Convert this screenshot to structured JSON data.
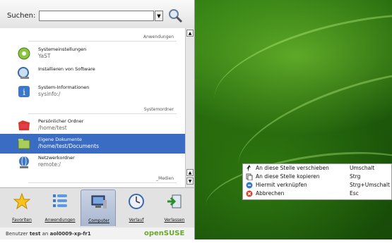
{
  "search": {
    "label": "Suchen:",
    "value": ""
  },
  "sections": {
    "applications": "Anwendungen",
    "system_folders": "Systemordner",
    "media": "_Medien"
  },
  "items": [
    {
      "title": "Systemeinstellungen",
      "subtitle": "YaST",
      "icon": "yast-icon"
    },
    {
      "title": "Installieren von Software",
      "subtitle": "",
      "icon": "software-install-icon"
    },
    {
      "title": "System-Informationen",
      "subtitle": "sysinfo:/",
      "icon": "info-icon"
    },
    {
      "title": "Persönlicher Ordner",
      "subtitle": "/home/test",
      "icon": "home-folder-icon"
    },
    {
      "title": "Eigene Dokumente",
      "subtitle": "/home/test/Documents",
      "icon": "documents-folder-icon"
    },
    {
      "title": "Netzwerkordner",
      "subtitle": "remote:/",
      "icon": "network-folder-icon"
    }
  ],
  "tabs": [
    {
      "label": "Favoriten",
      "icon": "star-icon"
    },
    {
      "label": "Anwendungen",
      "icon": "applications-list-icon"
    },
    {
      "label": "Computer",
      "icon": "computer-icon"
    },
    {
      "label": "Verlauf",
      "icon": "clock-icon"
    },
    {
      "label": "Verlassen",
      "icon": "leave-icon"
    }
  ],
  "footer": {
    "prefix": "Benutzer ",
    "user": "test",
    "middle": " an ",
    "host": "aol0009-xp-fr1",
    "brand": "openSUSE"
  },
  "context_menu": [
    {
      "label": "An diese Stelle verschieben",
      "shortcut": "Umschalt",
      "icon": "move-icon"
    },
    {
      "label": "An diese Stelle kopieren",
      "shortcut": "Strg",
      "icon": "copy-icon"
    },
    {
      "label": "Hiermit verknüpfen",
      "shortcut": "Strg+Umschalt",
      "icon": "link-icon"
    },
    {
      "label": "Abbrechen",
      "shortcut": "Esc",
      "icon": "cancel-icon"
    }
  ],
  "colors": {
    "selection": "#3b6cc4",
    "desktop": "#2f7a12",
    "brand": "#6aa82b"
  }
}
